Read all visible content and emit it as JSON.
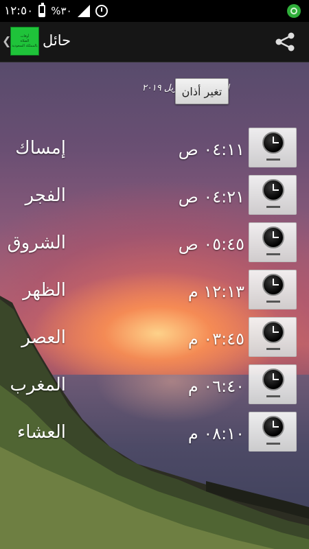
{
  "status_bar": {
    "time": "١٢:٥٠",
    "battery_percent": "%٣٠",
    "battery_level": 0.3
  },
  "action_bar": {
    "title": "حائل",
    "logo_text": [
      "أوقات",
      "الصلاة",
      "بالمملكة السعودية"
    ],
    "back_icon": "chevron-left-icon",
    "share_icon": "share-icon"
  },
  "header": {
    "date": "الجمعة , ١٩ ابريل ٢٠١٩",
    "change_adhan_label": "تغير أذان"
  },
  "prayers": [
    {
      "name": "إمساك",
      "time": "٠٤:١١ ص"
    },
    {
      "name": "الفجر",
      "time": "٠٤:٢١ ص"
    },
    {
      "name": "الشروق",
      "time": "٠٥:٤٥ ص"
    },
    {
      "name": "الظهر",
      "time": "١٢:١٣ م"
    },
    {
      "name": "العصر",
      "time": "٠٣:٤٥ م"
    },
    {
      "name": "المغرب",
      "time": "٠٦:٤٠ م"
    },
    {
      "name": "العشاء",
      "time": "٠٨:١٠ م"
    }
  ]
}
